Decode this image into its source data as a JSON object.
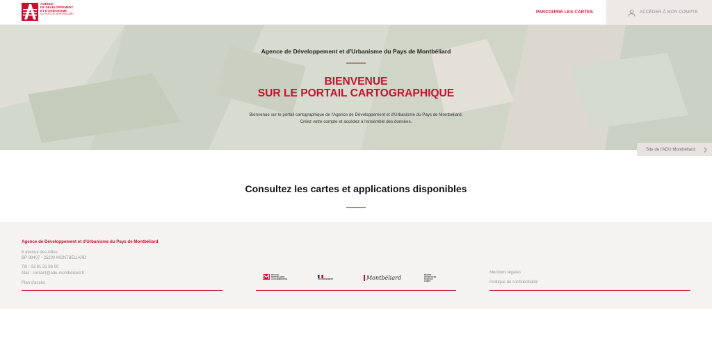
{
  "header": {
    "logo_text": [
      "Agence",
      "de développement",
      "et d'urbanisme"
    ],
    "logo_sub": "du pays de Montbéliard",
    "nav_maps": "PARCOURIR LES CARTES",
    "nav_account": "ACCÉDER À MON COMPTE"
  },
  "hero": {
    "agency": "Agence de Développement et d'Urbanisme du Pays de Montbéliard",
    "title_line1": "BIENVENUE",
    "title_line2": "SUR LE PORTAIL CARTOGRAPHIQUE",
    "desc_line1": "Bienvenue sur le portail cartographique de l'Agence de Développement et d'Urbanisme du Pays de Montbéliard.",
    "desc_line2": "Créez votre compte et accédez à l'ensemble des données.",
    "site_link": "Site de l'ADU Montbéliard"
  },
  "section": {
    "title": "Consultez les cartes et applications disponibles"
  },
  "footer": {
    "agency": "Agence de Développement et d'Urbanisme du Pays de Montbéliard",
    "address1": "8 avenue des Alliés",
    "address2": "BP 98407 - 25200 MONTBÉLIARD",
    "tel": "Tél : 03 81 31 86 00",
    "mail": "Mail : contact@adu-montbeliard.fr",
    "plan": "Plan d'accès",
    "partners": {
      "pays": "Pays de Montbéliard Agglomération",
      "gouv": "GOUVERNEMENT",
      "montbeliard": "Montbéliard",
      "region": [
        "RÉGION",
        "BOURGOGNE",
        "FRANCHE",
        "COMTÉ"
      ]
    },
    "legal": "Mentions légales",
    "privacy": "Politique de confidentialité"
  },
  "colors": {
    "brand_red": "#c8102e",
    "accent_rule": "#a38c84",
    "footer_bg": "#f4f3f2"
  }
}
